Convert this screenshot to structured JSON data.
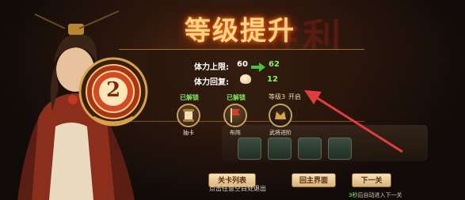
{
  "banner": {
    "title": "等级提升",
    "bg_text": "胜利",
    "level": "2"
  },
  "stats": [
    {
      "label": "体力上限:",
      "old": "60",
      "new": "62"
    },
    {
      "label": "体力回复:",
      "value": "12"
    }
  ],
  "unlocks": [
    {
      "status": "已解锁",
      "label": "抽卡",
      "icon": "card-scroll-icon"
    },
    {
      "status": "已解锁",
      "label": "布阵",
      "icon": "formation-flag-icon"
    },
    {
      "status": "等级3",
      "status_suffix": "开启",
      "label": "武将进阶",
      "icon": "hero-advance-icon"
    }
  ],
  "buttons": {
    "stage_list": "关卡列表",
    "main_screen": "回主界面",
    "next": "下一关"
  },
  "hint": "点击任意空白处退出",
  "auto_next": {
    "countdown": "3秒",
    "text": "后自动进入下一关"
  },
  "colors": {
    "accent_green": "#8ef05e",
    "title_gold": "#ffd48a",
    "annotation_red": "#e23c3c"
  }
}
